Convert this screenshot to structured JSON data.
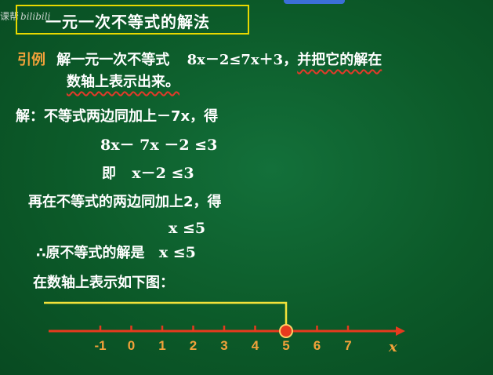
{
  "watermark": {
    "prefix": "课帮",
    "logo": "bilibili"
  },
  "title": "一元一次不等式的解法",
  "example": {
    "label": "引例",
    "text1": "解一元一次不等式",
    "inequality": "8x－2≤7x＋3，",
    "text2": "并把它的解在",
    "line2": "数轴上表示出来。"
  },
  "solution": {
    "line1": "解：不等式两边同加上－7x，得",
    "step1": "8x－ 7x －2 ≤3",
    "step2_prefix": "即",
    "step2": "x－2 ≤3",
    "line2": "再在不等式的两边同加上2，得",
    "step3": "x ≤5",
    "conclusion_prefix": "∴原不等式的解是",
    "conclusion": "x ≤5",
    "line3": "在数轴上表示如下图："
  },
  "number_line": {
    "ticks": [
      "-1",
      "0",
      "1",
      "2",
      "3",
      "4",
      "5",
      "6",
      "7"
    ],
    "axis_label": "x",
    "solution_bound": 5,
    "direction": "left",
    "endpoint": "closed",
    "colors": {
      "axis": "#e63a1e",
      "ray": "#f2e23a",
      "labels": "#f2a23a",
      "point": "#e63a1e"
    }
  }
}
